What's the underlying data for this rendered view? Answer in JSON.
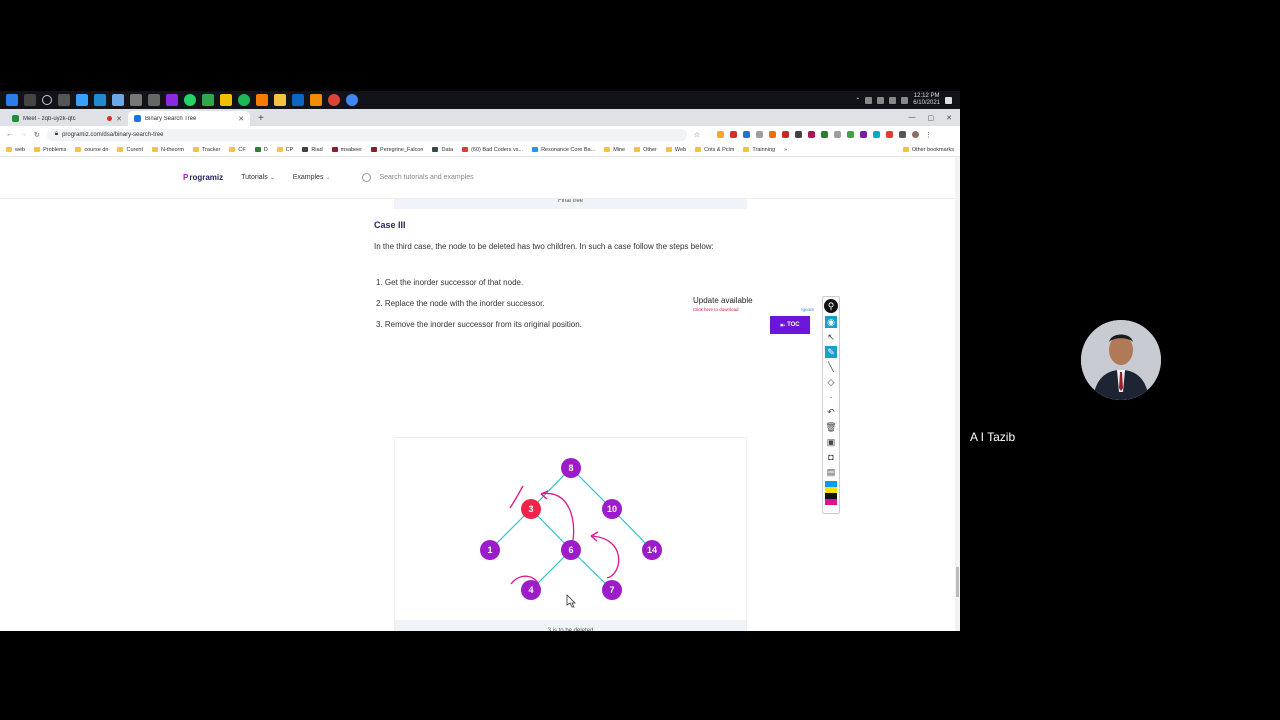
{
  "taskbar": {
    "clock_time": "12:12 PM",
    "clock_date": "6/10/2021"
  },
  "tabs": [
    {
      "title": "Meet - zqb-uyzk-qtc",
      "favicon_color": "#1e8e3e",
      "recording": true
    },
    {
      "title": "Binary Search Tree",
      "favicon_color": "#1a73e8",
      "recording": false
    }
  ],
  "address": {
    "url": "programiz.com/dsa/binary-search-tree"
  },
  "bookmarks": [
    "web",
    "Problems",
    "course dn",
    "Curent",
    "N-theorm",
    "Tracker",
    "CF",
    "D",
    "CP",
    "Riad",
    "msabeer",
    "Peregrine_Falcon",
    "Data",
    "(60) Bad Coders vs...",
    "Resonance Core Ba...",
    "Mine",
    "Other",
    "Web",
    "Cnts & Pclm",
    "Trainning"
  ],
  "bookmarks_more": "»",
  "bookmarks_other": "Other bookmarks",
  "header": {
    "logo_mark": "P",
    "logo_rest": "rogramiz",
    "nav_tutorials": "Tutorials",
    "nav_examples": "Examples",
    "search_placeholder": "Search tutorials and examples"
  },
  "content": {
    "prev_caption": "Final tree",
    "case_heading": "Case III",
    "intro": "In the third case, the node to be deleted has two children. In such a case follow the steps below:",
    "steps": [
      "1. Get the inorder successor of that node.",
      "2. Replace the node with the inorder successor.",
      "3. Remove the inorder successor from its original position."
    ],
    "figure_caption": "3 is to be deleted"
  },
  "tree1": {
    "nodes": [
      {
        "label": "8",
        "highlight": false
      },
      {
        "label": "3",
        "highlight": true
      },
      {
        "label": "10",
        "highlight": false
      },
      {
        "label": "1",
        "highlight": false
      },
      {
        "label": "6",
        "highlight": false
      },
      {
        "label": "14",
        "highlight": false
      },
      {
        "label": "4",
        "highlight": false
      },
      {
        "label": "7",
        "highlight": false
      }
    ]
  },
  "tree2": {
    "nodes": [
      {
        "label": "8",
        "highlight": false
      },
      {
        "label": "3",
        "highlight": true
      },
      {
        "label": "10",
        "highlight": false
      }
    ]
  },
  "colors": {
    "node": "#9c1cc9",
    "node_highlight": "#f0244a",
    "edge": "#27c7c7",
    "annotation": "#e0148c",
    "toc": "#6b16d9"
  },
  "update_popup": {
    "title": "Update available",
    "subtitle": "Click here to download",
    "ignore": "Ignore"
  },
  "toc_label": "TOC",
  "participant": {
    "name": "A I Tazib"
  }
}
